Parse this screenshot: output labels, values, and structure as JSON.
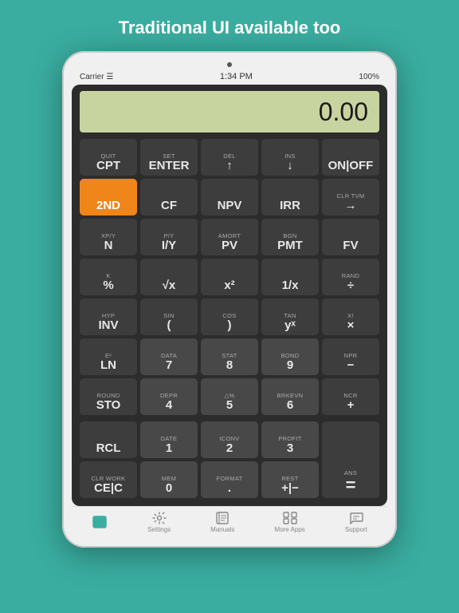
{
  "header": {
    "title": "Traditional UI available too"
  },
  "ipad": {
    "status": {
      "carrier": "Carrier ☰",
      "time": "1:34 PM",
      "battery": "100%"
    },
    "display": {
      "value": "0.00"
    },
    "buttons": [
      [
        {
          "label": "CPT",
          "sub": "QUIT",
          "type": "dark"
        },
        {
          "label": "ENTER",
          "sub": "SET",
          "type": "dark"
        },
        {
          "label": "↑",
          "sub": "DEL",
          "type": "dark"
        },
        {
          "label": "↓",
          "sub": "INS",
          "type": "dark"
        },
        {
          "label": "ON|OFF",
          "sub": "",
          "type": "dark"
        }
      ],
      [
        {
          "label": "2ND",
          "sub": "",
          "type": "orange"
        },
        {
          "label": "CF",
          "sub": "",
          "type": "dark"
        },
        {
          "label": "NPV",
          "sub": "",
          "type": "dark"
        },
        {
          "label": "IRR",
          "sub": "",
          "type": "dark"
        },
        {
          "label": "→",
          "sub": "CLR TVM",
          "type": "dark"
        }
      ],
      [
        {
          "label": "N",
          "sub": "xP/Y",
          "type": "dark"
        },
        {
          "label": "I/Y",
          "sub": "P/Y",
          "type": "dark"
        },
        {
          "label": "PV",
          "sub": "AMORT",
          "type": "dark"
        },
        {
          "label": "PMT",
          "sub": "BGN",
          "type": "dark"
        },
        {
          "label": "FV",
          "sub": "",
          "type": "dark"
        }
      ],
      [
        {
          "label": "%",
          "sub": "K",
          "type": "dark"
        },
        {
          "label": "√x",
          "sub": "",
          "type": "dark"
        },
        {
          "label": "x²",
          "sub": "",
          "type": "dark"
        },
        {
          "label": "1/x",
          "sub": "",
          "type": "dark"
        },
        {
          "label": "÷",
          "sub": "RAND",
          "type": "dark"
        }
      ],
      [
        {
          "label": "INV",
          "sub": "HYP",
          "type": "dark"
        },
        {
          "label": "(",
          "sub": "SIN",
          "type": "dark"
        },
        {
          "label": ")",
          "sub": "COS",
          "type": "dark"
        },
        {
          "label": "yˣ",
          "sub": "TAN",
          "type": "dark"
        },
        {
          "label": "×",
          "sub": "x!",
          "type": "dark"
        }
      ],
      [
        {
          "label": "LN",
          "sub": "eˣ",
          "type": "dark"
        },
        {
          "label": "7",
          "sub": "DATA",
          "type": "medium"
        },
        {
          "label": "8",
          "sub": "STAT",
          "type": "medium"
        },
        {
          "label": "9",
          "sub": "BOND",
          "type": "medium"
        },
        {
          "label": "−",
          "sub": "nPr",
          "type": "dark"
        }
      ],
      [
        {
          "label": "STO",
          "sub": "ROUND",
          "type": "dark"
        },
        {
          "label": "4",
          "sub": "DEPR",
          "type": "medium"
        },
        {
          "label": "5",
          "sub": "△%",
          "type": "medium"
        },
        {
          "label": "6",
          "sub": "BRKEVN",
          "type": "medium"
        },
        {
          "label": "+",
          "sub": "nCr",
          "type": "dark"
        }
      ],
      [
        {
          "label": "RCL",
          "sub": "",
          "type": "dark"
        },
        {
          "label": "1",
          "sub": "DATE",
          "type": "medium"
        },
        {
          "label": "2",
          "sub": "ICONV",
          "type": "medium"
        },
        {
          "label": "3",
          "sub": "PROFIT",
          "type": "medium"
        },
        {
          "label": "=",
          "sub": "ANS",
          "type": "dark",
          "rowspan": 2
        }
      ],
      [
        {
          "label": "CE|C",
          "sub": "CLR WORK",
          "type": "dark"
        },
        {
          "label": "0",
          "sub": "MEM",
          "type": "medium"
        },
        {
          "label": ".",
          "sub": "FORMAT",
          "type": "medium"
        },
        {
          "label": "+|−",
          "sub": "REST",
          "type": "medium"
        }
      ]
    ],
    "nav": [
      {
        "label": "",
        "active": true,
        "icon": "calc"
      },
      {
        "label": "Settings",
        "active": false,
        "icon": "gear"
      },
      {
        "label": "Manuals",
        "active": false,
        "icon": "book"
      },
      {
        "label": "More Apps",
        "active": false,
        "icon": "apps"
      },
      {
        "label": "Support",
        "active": false,
        "icon": "chat"
      }
    ]
  }
}
